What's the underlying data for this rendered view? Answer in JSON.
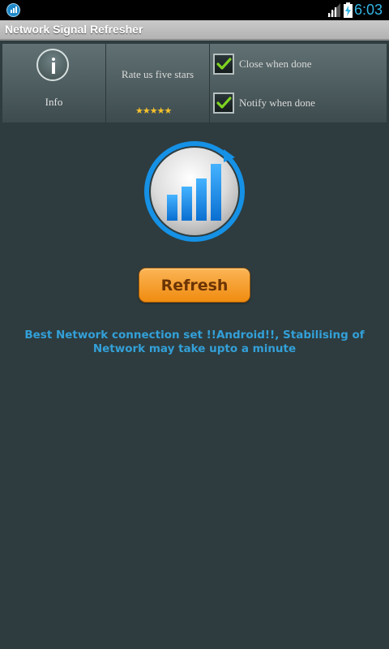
{
  "status_bar": {
    "time": "6:03",
    "icons": [
      "app-signal-icon",
      "cell-signal-icon",
      "battery-charging-icon"
    ]
  },
  "titlebar": {
    "title": "Network Signal Refresher"
  },
  "panel": {
    "info": {
      "label": "Info",
      "icon": "info-icon"
    },
    "rate": {
      "label": "Rate us five stars",
      "stars": "★★★★★",
      "rating": 5
    },
    "options": [
      {
        "label": "Close when done",
        "checked": true
      },
      {
        "label": "Notify when done",
        "checked": true
      }
    ]
  },
  "main": {
    "logo_icon": "network-refresh-icon",
    "refresh_button_label": "Refresh",
    "status_message": "Best Network connection set !!Android!!, Stabilising of Network may take upto a minute"
  },
  "colors": {
    "background": "#2e3c3f",
    "accent_blue": "#33a0d8",
    "button_orange": "#f29b24",
    "check_green": "#7ed321"
  }
}
